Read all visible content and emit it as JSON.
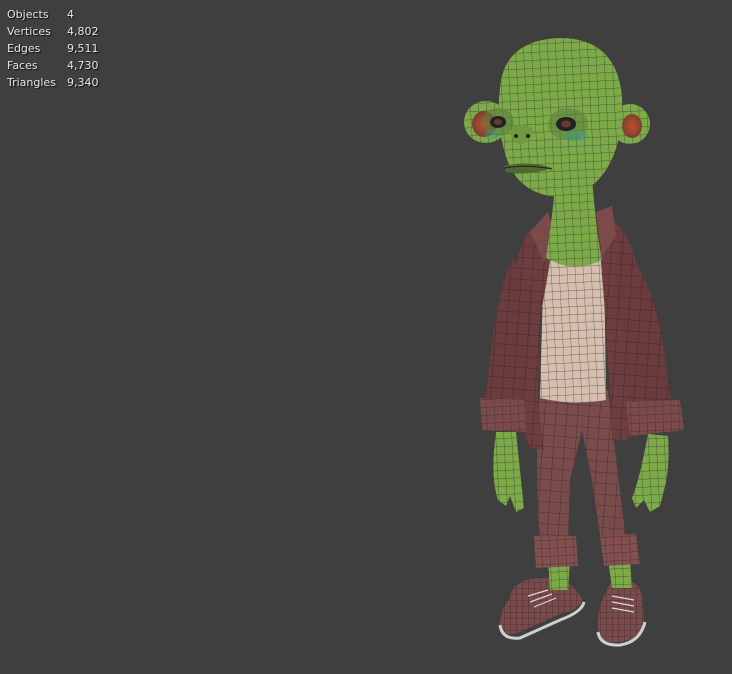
{
  "overlay": {
    "stats": [
      {
        "label": "Objects",
        "value": "4"
      },
      {
        "label": "Vertices",
        "value": "4,802"
      },
      {
        "label": "Edges",
        "value": "9,511"
      },
      {
        "label": "Faces",
        "value": "4,730"
      },
      {
        "label": "Triangles",
        "value": "9,340"
      }
    ]
  },
  "viewport": {
    "background": "#3f3f3f",
    "model": "cartoon-character-wireframe"
  },
  "colors": {
    "skin": "#7dab4a",
    "jacket": "#6e3d3f",
    "shirt": "#d6bfae",
    "pants": "#7a4b4b",
    "wire": "#1f1f1f",
    "ear_inner": "#b24b2a"
  }
}
